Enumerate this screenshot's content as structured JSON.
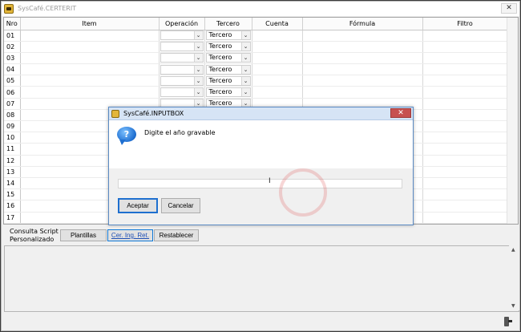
{
  "window": {
    "title": "SysCafé.CERTERIT",
    "close_glyph": "✕"
  },
  "grid": {
    "columns": [
      "Nro",
      "Item",
      "Operación",
      "Tercero",
      "Cuenta",
      "Fórmula",
      "Filtro"
    ],
    "rows": [
      {
        "nro": "01",
        "tercero": "Tercero"
      },
      {
        "nro": "02",
        "tercero": "Tercero"
      },
      {
        "nro": "03",
        "tercero": "Tercero"
      },
      {
        "nro": "04",
        "tercero": "Tercero"
      },
      {
        "nro": "05",
        "tercero": "Tercero"
      },
      {
        "nro": "06",
        "tercero": "Tercero"
      },
      {
        "nro": "07",
        "tercero": "Tercero"
      },
      {
        "nro": "08",
        "tercero": ""
      },
      {
        "nro": "09",
        "tercero": ""
      },
      {
        "nro": "10",
        "tercero": ""
      },
      {
        "nro": "11",
        "tercero": ""
      },
      {
        "nro": "12",
        "tercero": ""
      },
      {
        "nro": "13",
        "tercero": ""
      },
      {
        "nro": "14",
        "tercero": ""
      },
      {
        "nro": "15",
        "tercero": ""
      },
      {
        "nro": "16",
        "tercero": ""
      },
      {
        "nro": "17",
        "tercero": ""
      }
    ],
    "dropdown_glyph": "⌄"
  },
  "toolbar": {
    "consulta_label": "Consulta Script Personalizado",
    "plantillas": "Plantillas",
    "cer_ing_ret": "Cer. Ing. Ret.",
    "restablecer": "Restablecer"
  },
  "script_area": {
    "value": "",
    "up_glyph": "▲",
    "down_glyph": "▼"
  },
  "dialog": {
    "title": "SysCafé.INPUTBOX",
    "close_glyph": "✕",
    "icon_glyph": "?",
    "prompt": "Digite el año gravable",
    "input_value": "",
    "accept": "Aceptar",
    "cancel": "Cancelar"
  },
  "colors": {
    "dialog_border": "#5a8ac3",
    "close_red": "#c75050",
    "link_blue": "#1d4fb5"
  }
}
